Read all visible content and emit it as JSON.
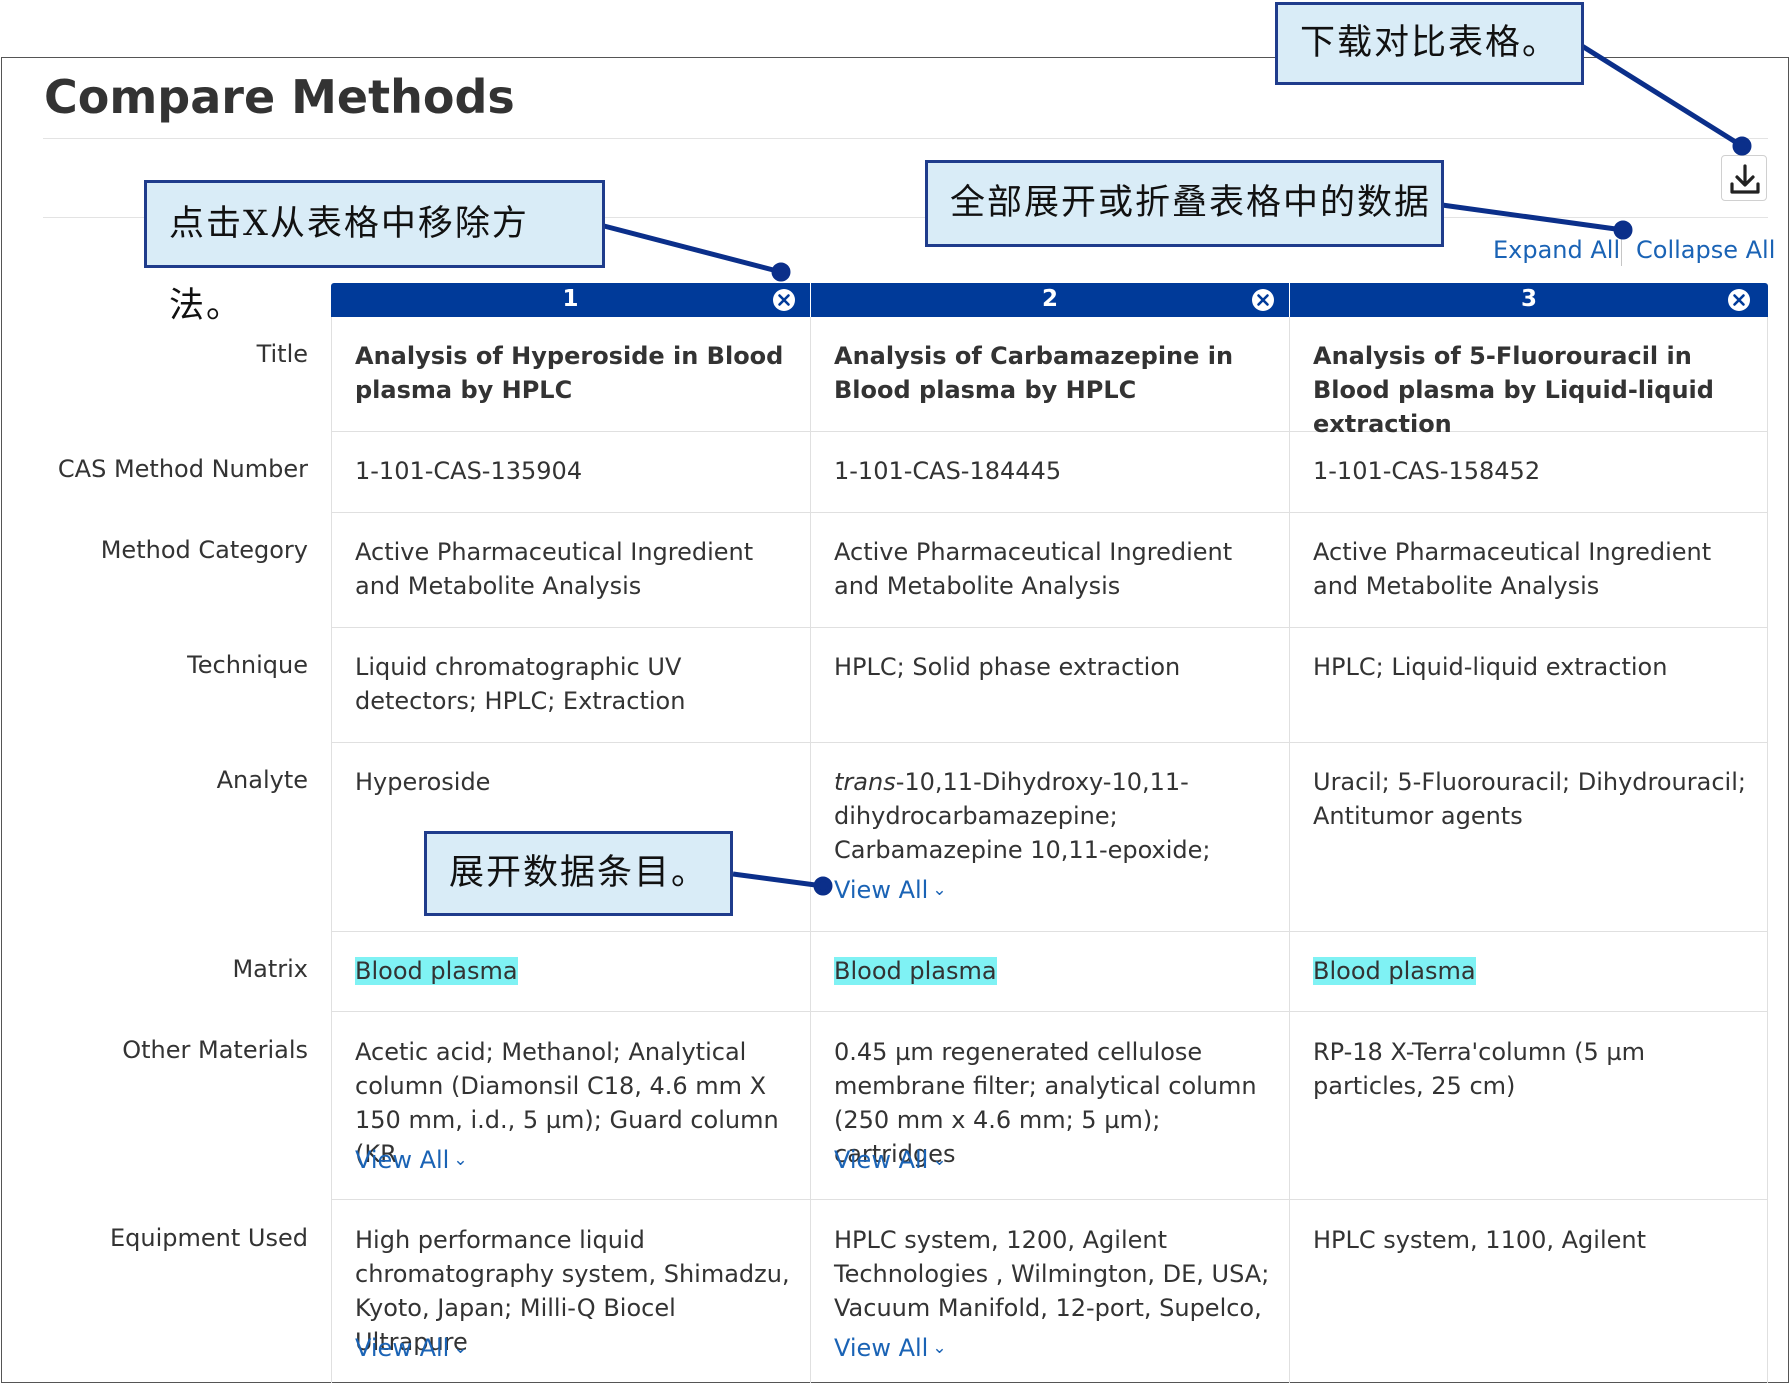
{
  "page": {
    "title": "Compare Methods"
  },
  "toolbar": {
    "download_icon": "download-icon",
    "expand_all": "Expand All",
    "collapse_all": "Collapse All"
  },
  "columns": [
    {
      "number": "1"
    },
    {
      "number": "2"
    },
    {
      "number": "3"
    }
  ],
  "rows": {
    "title": {
      "label": "Title",
      "values": [
        "Analysis of Hyperoside in Blood plasma by HPLC",
        "Analysis of Carbamazepine in Blood plasma by HPLC",
        "Analysis of 5-Fluorouracil in Blood plasma by Liquid-liquid extraction"
      ]
    },
    "cas": {
      "label": "CAS Method Number",
      "values": [
        "1-101-CAS-135904",
        "1-101-CAS-184445",
        "1-101-CAS-158452"
      ]
    },
    "category": {
      "label": "Method Category",
      "values": [
        "Active Pharmaceutical Ingredient and Metabolite Analysis",
        "Active Pharmaceutical Ingredient and Metabolite Analysis",
        "Active Pharmaceutical Ingredient and Metabolite Analysis"
      ]
    },
    "technique": {
      "label": "Technique",
      "values": [
        "Liquid chromatographic UV detectors; HPLC; Extraction",
        "HPLC; Solid phase extraction",
        "HPLC; Liquid-liquid extraction"
      ]
    },
    "analyte": {
      "label": "Analyte",
      "values": [
        "Hyperoside",
        "",
        "Uracil; 5-Fluorouracil; Dihydrouracil; Antitumor agents"
      ],
      "col2_italic": "trans",
      "col2_rest": "-10,11-Dihydroxy-10,11-dihydrocarbamazepine; Carbamazepine 10,11-epoxide;"
    },
    "matrix": {
      "label": "Matrix",
      "values": [
        "Blood plasma",
        "Blood plasma",
        "Blood plasma"
      ]
    },
    "other_materials": {
      "label": "Other Materials",
      "values": [
        "Acetic acid; Methanol; Analytical column (Diamonsil C18, 4.6 mm X 150 mm, i.d., 5 µm); Guard column (KR",
        "0.45 µm regenerated cellulose membrane filter; analytical column (250 mm x 4.6 mm; 5 µm); cartridges",
        "RP-18 X-Terra'column (5 µm particles, 25 cm)"
      ]
    },
    "equipment": {
      "label": "Equipment Used",
      "values": [
        "High performance liquid chromatography system, Shimadzu, Kyoto, Japan; Milli-Q Biocel Ultrapure",
        "HPLC system, 1200, Agilent Technologies , Wilmington, DE, USA; Vacuum Manifold, 12-port, Supelco,",
        "HPLC system, 1100, Agilent"
      ]
    }
  },
  "view_all": "View All",
  "callouts": {
    "download": "下载对比表格。",
    "expand_collapse": "全部展开或折叠表格中的数据",
    "remove": "点击X从表格中移除方法。",
    "view_all": "展开数据条目。"
  },
  "colors": {
    "header_blue": "#003a99",
    "link_blue": "#1a63b5",
    "highlight": "#7ff2f4",
    "callout_bg": "#d9ecf7",
    "callout_border": "#1f3c8c"
  }
}
